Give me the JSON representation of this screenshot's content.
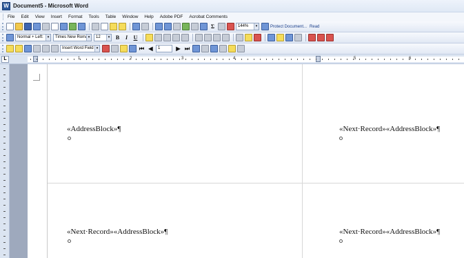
{
  "window": {
    "title": "Document5 - Microsoft Word",
    "icon": "word-app-icon"
  },
  "menu": [
    "File",
    "Edit",
    "View",
    "Insert",
    "Format",
    "Tools",
    "Table",
    "Window",
    "Help",
    "Adobe PDF",
    "Acrobat Comments"
  ],
  "toolbar_standard": {
    "zoom": "144%",
    "protect_label": "Protect Document...",
    "read_label": "Read"
  },
  "toolbar_formatting": {
    "style": "Normal + Left:",
    "font": "Times New Roman",
    "size": "12",
    "bold": "B",
    "italic": "I",
    "underline": "U"
  },
  "toolbar_mailmerge": {
    "insert_word_field": "Insert Word Field",
    "record_number": "1"
  },
  "ruler": {
    "numbers": [
      "1",
      "2",
      "3",
      "4",
      "5",
      "6"
    ]
  },
  "document": {
    "cells": [
      {
        "text": "«AddressBlock»¶"
      },
      {
        "text": "«Next·Record»«AddressBlock»¶"
      },
      {
        "text": "«Next·Record»«AddressBlock»¶"
      },
      {
        "text": "«Next·Record»«AddressBlock»¶"
      }
    ]
  }
}
